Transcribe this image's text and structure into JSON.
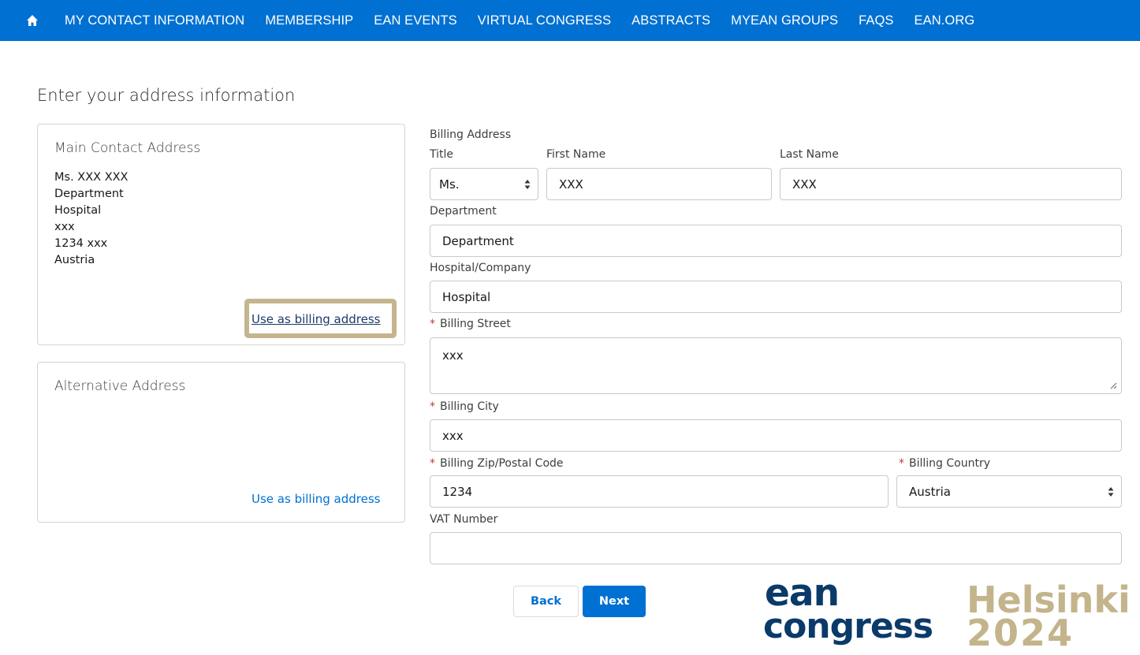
{
  "nav": {
    "home_icon": "home-icon",
    "items": [
      "MY CONTACT INFORMATION",
      "MEMBERSHIP",
      "EAN EVENTS",
      "VIRTUAL CONGRESS",
      "ABSTRACTS",
      "MYEAN GROUPS",
      "FAQS",
      "EAN.ORG"
    ]
  },
  "page_title": "Enter your address information",
  "main_card": {
    "title": "Main Contact Address",
    "lines": [
      "Ms. XXX XXX",
      "Department",
      "Hospital",
      "xxx",
      "1234 xxx",
      "Austria"
    ],
    "link": "Use as billing address"
  },
  "alt_card": {
    "title": "Alternative Address",
    "link": "Use as billing address"
  },
  "form": {
    "section_label": "Billing Address",
    "title_label": "Title",
    "title_value": "Ms.",
    "first_name_label": "First Name",
    "first_name_value": "XXX",
    "last_name_label": "Last Name",
    "last_name_value": "XXX",
    "department_label": "Department",
    "department_value": "Department",
    "hospital_label": "Hospital/Company",
    "hospital_value": "Hospital",
    "street_label": "Billing Street",
    "street_value": "xxx",
    "city_label": "Billing City",
    "city_value": "xxx",
    "zip_label": "Billing Zip/Postal Code",
    "zip_value": "1234",
    "country_label": "Billing Country",
    "country_value": "Austria",
    "vat_label": "VAT Number",
    "vat_value": "",
    "required_mark": "*"
  },
  "buttons": {
    "back": "Back",
    "next": "Next"
  },
  "logo": {
    "line1": "ean",
    "line2": "congress",
    "city": "Helsinki",
    "year": "2024"
  },
  "colors": {
    "nav_bg": "#0070d2",
    "link": "#0070d2",
    "highlight": "#c4b58e",
    "required": "#c23934",
    "logo_blue": "#0a3a6a",
    "logo_gold": "#c3b48b"
  }
}
